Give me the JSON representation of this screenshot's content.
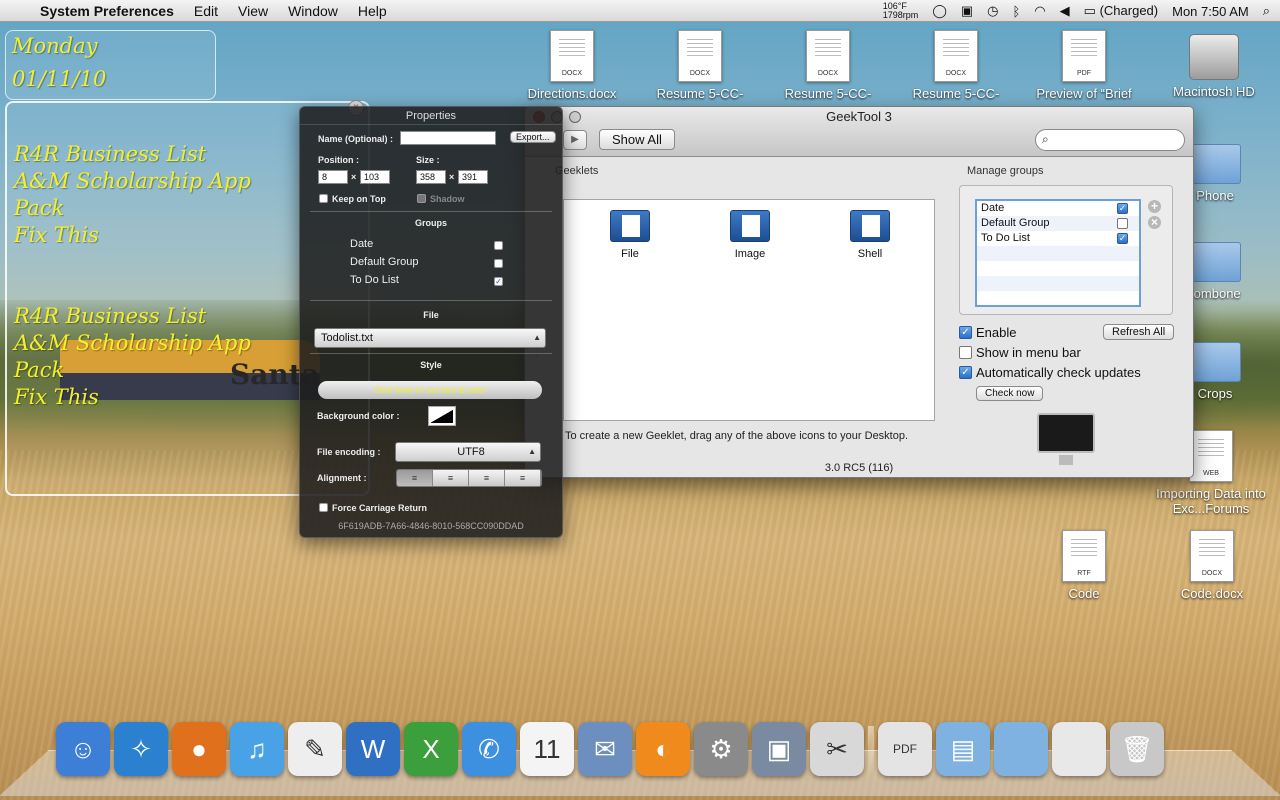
{
  "menubar": {
    "app": "System Preferences",
    "items": [
      "Edit",
      "View",
      "Window",
      "Help"
    ],
    "temp": "106°F",
    "rpm": "1798rpm",
    "battery": "(Charged)",
    "clock": "Mon 7:50 AM"
  },
  "geeklet_date": {
    "day": "Monday",
    "date": "01/11/10"
  },
  "geeklet_todo": {
    "lines": [
      "R4R Business List",
      "A&M Scholarship App",
      "Pack",
      "Fix This"
    ],
    "shadow_lines": [
      "R4R Business List",
      "A&M Scholarship App",
      "Pack",
      "Fix This"
    ]
  },
  "desktop": {
    "docs": [
      {
        "label": "Directions.docx",
        "type": "DOCX"
      },
      {
        "label": "Resume 5-CC-",
        "type": "DOCX"
      },
      {
        "label": "Resume 5-CC-",
        "type": "DOCX"
      },
      {
        "label": "Resume 5-CC-",
        "type": "DOCX"
      },
      {
        "label": "Preview of “Brief",
        "type": "PDF"
      }
    ],
    "hd": "Macintosh HD",
    "folders": [
      "Phone",
      "rombone",
      "Crops"
    ],
    "web": "Importing Data into Exc...Forums",
    "web_type": "WEB",
    "rtf": {
      "label": "Code",
      "type": "RTF"
    },
    "codedoc": {
      "label": "Code.docx",
      "type": "DOCX"
    }
  },
  "geektool": {
    "title": "GeekTool 3",
    "show_all": "Show All",
    "geeklets_label": "Geeklets",
    "geeklets": [
      {
        "label": "File"
      },
      {
        "label": "Image"
      },
      {
        "label": "Shell"
      }
    ],
    "hint": "To create a new Geeklet, drag any of the above icons to your Desktop.",
    "version": "3.0 RC5 (116)",
    "manage_groups": "Manage groups",
    "groups": [
      {
        "name": "Date",
        "checked": true
      },
      {
        "name": "Default Group",
        "checked": false
      },
      {
        "name": "To Do List",
        "checked": true
      }
    ],
    "enable": "Enable",
    "refresh_all": "Refresh All",
    "show_menu_bar": "Show in menu bar",
    "auto_check": "Automatically check updates",
    "check_now": "Check now"
  },
  "properties": {
    "title": "Properties",
    "name_label": "Name (Optional) :",
    "name_value": "",
    "export": "Export...",
    "position_label": "Position :",
    "size_label": "Size :",
    "pos_x": "8",
    "pos_y": "103",
    "size_w": "358",
    "size_h": "391",
    "times": "×",
    "keep_on_top": "Keep on Top",
    "shadow": "Shadow",
    "groups_hdr": "Groups",
    "groups": [
      {
        "name": "Date",
        "checked": false
      },
      {
        "name": "Default Group",
        "checked": false
      },
      {
        "name": "To Do List",
        "checked": true
      }
    ],
    "file_hdr": "File",
    "file_value": "Todolist.txt",
    "style_hdr": "Style",
    "style_sample": "Click here to set font & color",
    "bg_color_label": "Background color :",
    "encoding_label": "File encoding :",
    "encoding_value": "UTF8",
    "alignment_label": "Alignment :",
    "force_cr": "Force Carriage Return",
    "uuid": "6F619ADB-7A66-4846-8010-568CC090DDAD"
  },
  "dock": {
    "items": [
      {
        "name": "Finder",
        "color": "#3d7fd6",
        "glyph": "☺"
      },
      {
        "name": "Safari",
        "color": "#2b80d0",
        "glyph": "✧"
      },
      {
        "name": "Firefox",
        "color": "#e0701c",
        "glyph": "●"
      },
      {
        "name": "iTunes",
        "color": "#4aa2e6",
        "glyph": "♫"
      },
      {
        "name": "Script",
        "color": "#eeeeee",
        "glyph": "✎"
      },
      {
        "name": "Word",
        "color": "#2f70c2",
        "glyph": "W"
      },
      {
        "name": "Excel",
        "color": "#3ba03b",
        "glyph": "X"
      },
      {
        "name": "iChat",
        "color": "#3d8fe0",
        "glyph": "✆"
      },
      {
        "name": "iCal",
        "color": "#f4f4f4",
        "glyph": "11"
      },
      {
        "name": "Mail",
        "color": "#6c8fc0",
        "glyph": "✉"
      },
      {
        "name": "Mozy",
        "color": "#f08a1c",
        "glyph": "◐"
      },
      {
        "name": "System Preferences",
        "color": "#8a8a8a",
        "glyph": "⚙"
      },
      {
        "name": "VMware",
        "color": "#7a8aa0",
        "glyph": "▣"
      },
      {
        "name": "Clipping",
        "color": "#d8d8d8",
        "glyph": "✂"
      }
    ],
    "right_items": [
      {
        "name": "Documents",
        "color": "#e4e4e4",
        "glyph": "PDF"
      },
      {
        "name": "Movies",
        "color": "#7fb2e0",
        "glyph": "▤"
      },
      {
        "name": "Folder",
        "color": "#7fb2e0",
        "glyph": ""
      },
      {
        "name": "Downloads",
        "color": "#e8e8e8",
        "glyph": ""
      },
      {
        "name": "Trash",
        "color": "#c8c8c8",
        "glyph": "🗑"
      }
    ]
  }
}
